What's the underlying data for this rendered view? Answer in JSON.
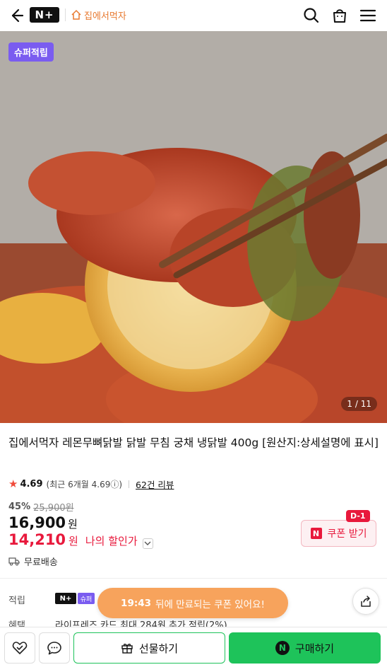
{
  "header": {
    "brand_logo": "N+",
    "store_name": "집에서먹자",
    "icons": [
      "back-arrow-icon",
      "search-icon",
      "bag-icon",
      "menu-icon"
    ]
  },
  "hero": {
    "badge": "슈퍼적립",
    "counter": "1 / 11"
  },
  "product": {
    "title": "집에서먹자 레몬무뼈닭발 닭발 무침 궁채 냉닭발 400g [원산지:상세설명에 표시]",
    "rating": "4.69",
    "rating_recent": "(최근 6개월 4.69ⓘ)",
    "review_link": "62건 리뷰",
    "discount_pct": "45%",
    "original_price": "25,900원",
    "price": "16,900",
    "price_unit": "원",
    "my_price": "14,210",
    "my_price_unit": "원",
    "my_price_label": "나의 할인가",
    "shipping": "무료배송"
  },
  "coupon": {
    "dday": "D-1",
    "label": "쿠폰 받기",
    "logo": "N"
  },
  "info": {
    "accum_label": "적립",
    "accum_badge_n": "N+",
    "accum_badge_super": "슈퍼",
    "benefit_label": "혜택",
    "benefit_text": "라이프레즈 카드 최대 284원 추가 적립(2%)"
  },
  "toast": {
    "time": "19:43",
    "text": "뒤에 만료되는 쿠폰 있어요!"
  },
  "bottom": {
    "gift_label": "선물하기",
    "buy_label": "구매하기",
    "buy_logo": "N"
  },
  "colors": {
    "accent_green": "#1ec35a",
    "sale_red": "#e8193c",
    "store_orange": "#e8792f",
    "super_purple": "#7a5cf0",
    "toast_orange": "#f7a35c"
  }
}
